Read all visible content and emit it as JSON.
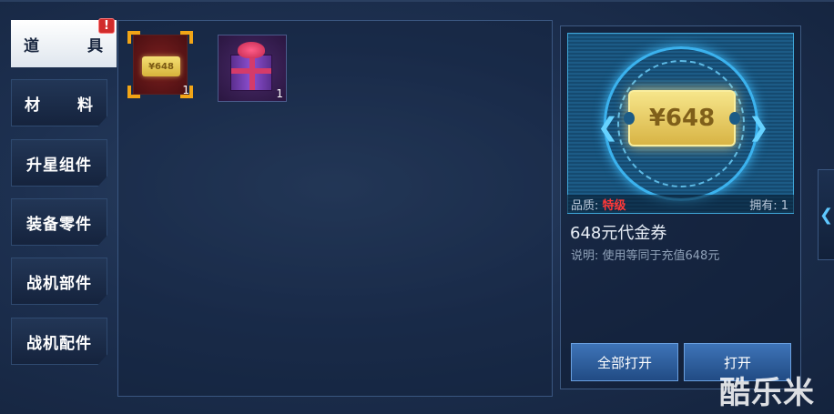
{
  "tabs": [
    {
      "label_left": "道",
      "label_right": "具",
      "active": true,
      "alert": "!"
    },
    {
      "label_left": "材",
      "label_right": "料",
      "active": false
    },
    {
      "label": "升星组件",
      "active": false
    },
    {
      "label": "装备零件",
      "active": false
    },
    {
      "label": "战机部件",
      "active": false
    },
    {
      "label": "战机配件",
      "active": false
    }
  ],
  "inventory": [
    {
      "icon": "coupon-icon",
      "mini_text": "¥648",
      "count": "1",
      "selected": true
    },
    {
      "icon": "gift-box-icon",
      "count": "1",
      "selected": false
    }
  ],
  "detail": {
    "coupon_text": "¥648",
    "quality_label": "品质:",
    "quality_value": "特级",
    "owned": "拥有: 1",
    "name": "648元代金券",
    "description": "说明: 使用等同于充值648元",
    "open_all_label": "全部打开",
    "open_label": "打开"
  },
  "colors": {
    "quality": "#ff3838",
    "selection": "#f2a516",
    "button": "#2d5d9e"
  },
  "watermark": "酷乐米"
}
